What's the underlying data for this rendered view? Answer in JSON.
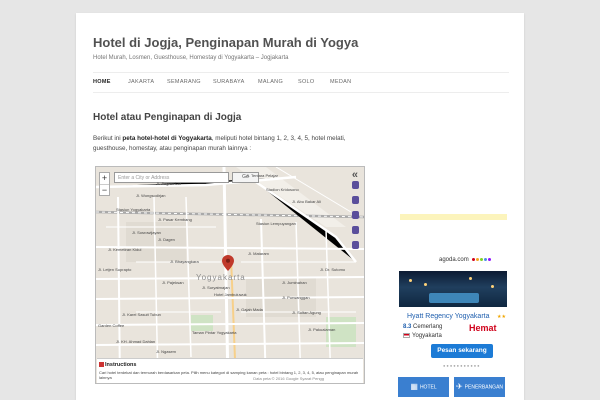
{
  "site": {
    "title": "Hotel di Jogja, Penginapan Murah di Yogya",
    "description": "Hotel Murah, Losmen, Guesthouse, Homestay di Yogyakarta – Jogjakarta"
  },
  "nav": {
    "items": [
      {
        "label": "HOME",
        "active": true
      },
      {
        "label": "JAKARTA"
      },
      {
        "label": "SEMARANG"
      },
      {
        "label": "SURABAYA"
      },
      {
        "label": "MALANG"
      },
      {
        "label": "SOLO"
      },
      {
        "label": "MEDAN"
      }
    ]
  },
  "entry": {
    "title": "Hotel atau Penginapan di Jogja",
    "text_before": "Berikut ini ",
    "text_bold": "peta hotel-hotel di Yogyakarta",
    "text_after": ", meliputi hotel bintang 1, 2, 3, 4, 5, hotel melati, guesthouse, homestay, atau penginapan murah lainnya :"
  },
  "map": {
    "zoom_in": "+",
    "zoom_out": "−",
    "search_placeholder": "Enter a City or Address",
    "go_label": "Go",
    "collapse_icon": "«",
    "city_label": "Yogyakarta",
    "labels": {
      "l1": "Stadion Kridosono",
      "l2": "Stasiun Yogyakarta",
      "l3": "Stasiun Lempuyangan",
      "l4": "Jl. Wongsodirjan",
      "l5": "Jl. Sosrowijayan",
      "l6": "Jl. Kemetiran Kidul",
      "l7": "Jl. Pajeksan",
      "l8": "Jl. Suryatmajan",
      "l9": "Hotel Jambuluwuk",
      "l10": "Jl. Juminahan",
      "l11": "Jl. Purwanggan",
      "l12": "Jl. Sultan Agung",
      "l13": "Taman Pintar Yogyakarta",
      "l14": "Jl. KH. Ahmad Dahlan",
      "l15": "Jl. Karel Sasuit Tubun",
      "l16": "Garden Coffee",
      "l17": "Jl. Mataram",
      "l18": "Jl. Pakualaman",
      "l19": "Jl. Dr. Sutomo",
      "l20": "Jl. Abu Bakar Ali",
      "l21": "Jl. Tentara Pelajar",
      "l22": "Jl. Letjen Suprapto",
      "l23": "Jl. Gajah Mada",
      "l24": "Jl. Jlagran Lor",
      "l25": "Jl. Pasar Kembang",
      "l26": "Jl. Dagen",
      "l27": "Jl. Bhayangkara",
      "l28": "Jl. Ngasem"
    },
    "instructions_title": "Instructions",
    "instructions_text": "Cari hotel terdekat dan termurah berdasarkan peta. Pilih menu kategori di samping kanan peta : hotel bintang 1, 2, 3, 4, 5, atau penginapan murah lainnya",
    "footer": "Data peta © 2016 Google    Syarat Pengg"
  },
  "agoda": {
    "brand": "agoda.com",
    "dot_colors": [
      "#d0021b",
      "#f5a623",
      "#7ed321",
      "#4a90e2",
      "#9013fe"
    ],
    "hotel_name": "Hyatt Regency Yogyakarta",
    "stars": "★★",
    "rating_value": "8.3",
    "rating_text": "Cemerlang",
    "city": "Yogyakarta",
    "hemat": "Hemat",
    "button": "Pesan sekarang",
    "pager": "●●●●●●●●●●●"
  },
  "tabs": {
    "hotel": "HOTEL",
    "penerbangan": "PENERBANGAN"
  },
  "colors": {
    "page_bg": "#e6e6e6",
    "link_blue": "#1f5fae",
    "button_blue": "#1c7bd6",
    "tab_blue": "#3a7fd0",
    "hemat_red": "#d0021b",
    "marker_red": "#c0392b"
  }
}
